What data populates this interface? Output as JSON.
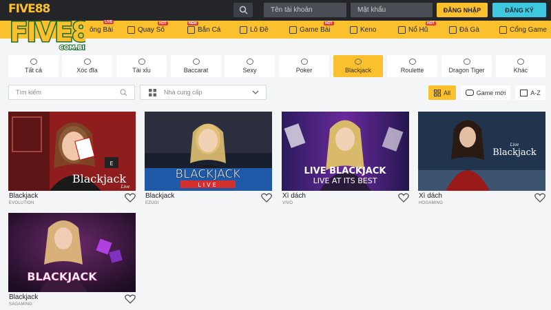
{
  "header": {
    "logo_small": "FIVE88",
    "username_placeholder": "Tên tài khoản",
    "password_placeholder": "Mật khẩu",
    "login_label": "ĐĂNG NHẬP",
    "register_label": "ĐĂNG KÝ"
  },
  "logo": {
    "main": "FIVE88",
    "domain": "COM.BIZ"
  },
  "nav": {
    "items": [
      {
        "label": "ông Bài",
        "badge": "LIVE"
      },
      {
        "label": "Quay Số",
        "badge": "HOT"
      },
      {
        "label": "Bắn Cá",
        "badge": "NEW"
      },
      {
        "label": "Lô Đề",
        "badge": ""
      },
      {
        "label": "Game Bài",
        "badge": "HOT"
      },
      {
        "label": "Keno",
        "badge": ""
      },
      {
        "label": "Nổ Hũ",
        "badge": "HOT"
      },
      {
        "label": "Đá Gà",
        "badge": ""
      },
      {
        "label": "Cổng Game",
        "badge": ""
      }
    ]
  },
  "categories": [
    {
      "label": "Tất cả",
      "icon": "dice-icon"
    },
    {
      "label": "Xóc đĩa",
      "icon": "xocdia-icon"
    },
    {
      "label": "Tài xỉu",
      "icon": "cube-icon"
    },
    {
      "label": "Baccarat",
      "icon": "cards-icon"
    },
    {
      "label": "Sexy",
      "icon": "lips-icon"
    },
    {
      "label": "Poker",
      "icon": "chips-icon"
    },
    {
      "label": "Blackjack",
      "icon": "blackjack-icon",
      "active": true
    },
    {
      "label": "Roulette",
      "icon": "roulette-icon"
    },
    {
      "label": "Dragon Tiger",
      "icon": "dragon-icon"
    },
    {
      "label": "Khác",
      "icon": "other-icon"
    }
  ],
  "filters": {
    "search_placeholder": "Tìm kiếm",
    "provider_placeholder": "Nhà cung cấp",
    "all_label": "All",
    "new_label": "Game mới",
    "az_label": "A-Z"
  },
  "games": [
    {
      "name": "Blackjack",
      "provider": "EVOLUTION",
      "thumb_text": "Blackjack",
      "thumb_sub": "Live"
    },
    {
      "name": "Blackjack",
      "provider": "EZUGI",
      "thumb_text": "BLACKJACK",
      "thumb_sub": "LIVE"
    },
    {
      "name": "Xì dách",
      "provider": "VIVO",
      "thumb_text": "LIVE BLACKJACK",
      "thumb_sub": "LIVE AT ITS BEST"
    },
    {
      "name": "Xì dách",
      "provider": "HOGAMING",
      "thumb_text": "Blackjack",
      "thumb_sub": "Live"
    },
    {
      "name": "Blackjack",
      "provider": "SAGAMING",
      "thumb_text": "BLACKJACK",
      "thumb_sub": ""
    }
  ],
  "colors": {
    "accent": "#fbc02d",
    "topbar": "#232529",
    "register": "#3ec8e0"
  }
}
